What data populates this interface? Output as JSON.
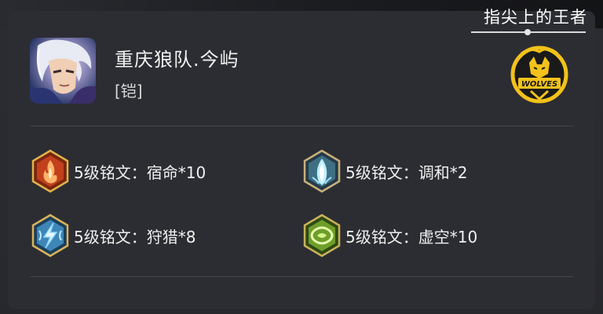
{
  "watermark": "指尖上的王者",
  "player": {
    "name": "重庆狼队.今屿",
    "role": "[铠]"
  },
  "team_logo_text": "WOLVES",
  "runes": [
    {
      "label": "5级铭文：宿命*10",
      "icon": "red-flame-rune-icon",
      "color": "#e0582a"
    },
    {
      "label": "5级铭文：调和*2",
      "icon": "cyan-leaf-rune-icon",
      "color": "#7fd6e8"
    },
    {
      "label": "5级铭文：狩猎*8",
      "icon": "blue-lightning-rune-icon",
      "color": "#58b8e8"
    },
    {
      "label": "5级铭文：虚空*10",
      "icon": "green-knot-rune-icon",
      "color": "#8fc23a"
    }
  ]
}
